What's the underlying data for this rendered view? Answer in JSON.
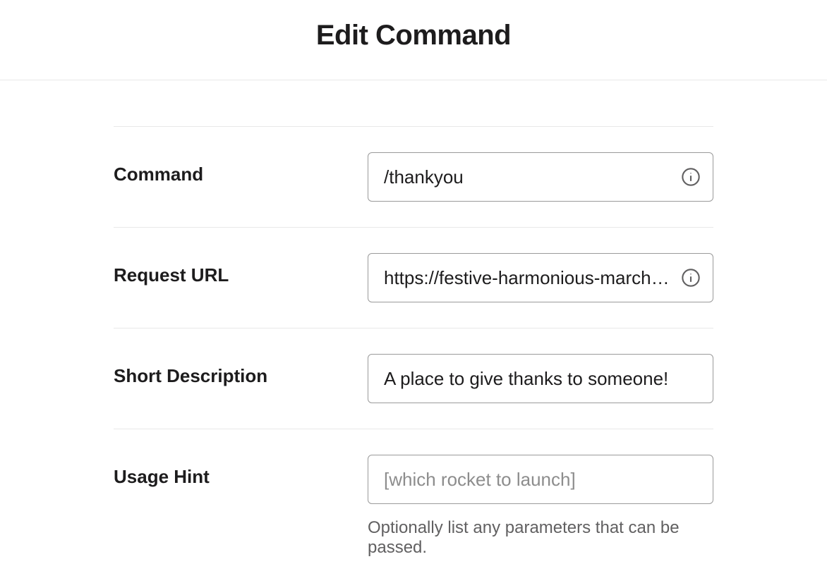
{
  "header": {
    "title": "Edit Command"
  },
  "form": {
    "command": {
      "label": "Command",
      "value": "/thankyou"
    },
    "request_url": {
      "label": "Request URL",
      "value": "https://festive-harmonious-march.gl…"
    },
    "short_description": {
      "label": "Short Description",
      "value": "A place to give thanks to someone!"
    },
    "usage_hint": {
      "label": "Usage Hint",
      "value": "",
      "placeholder": "[which rocket to launch]",
      "help": "Optionally list any parameters that can be passed."
    }
  }
}
